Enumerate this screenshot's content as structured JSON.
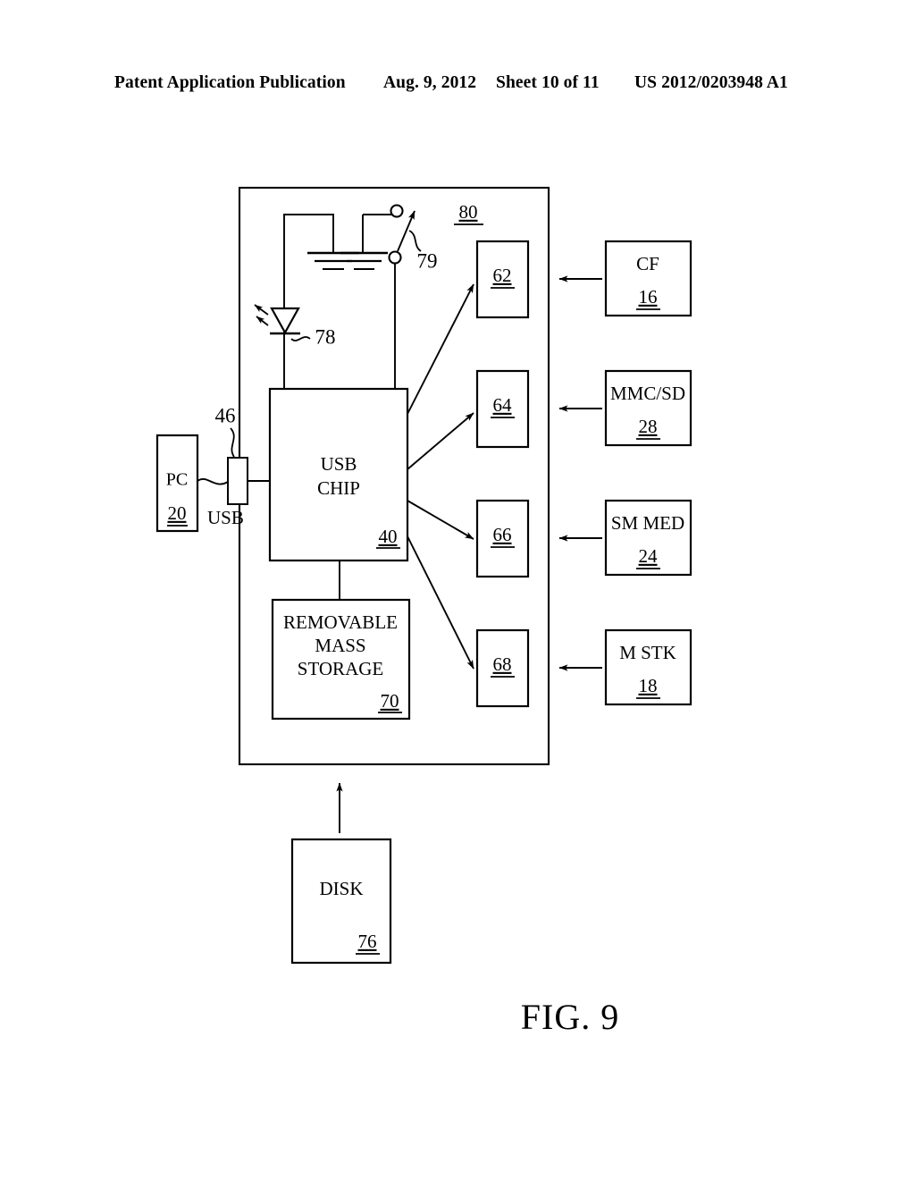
{
  "header": {
    "publication": "Patent Application Publication",
    "date": "Aug. 9, 2012",
    "sheet": "Sheet 10 of 11",
    "number": "US 2012/0203948 A1"
  },
  "figure": {
    "caption": "FIG. 9",
    "enclosure_ref": "80",
    "blocks": [
      {
        "id": "pc",
        "title": "PC",
        "ref": "20"
      },
      {
        "id": "usb-chip",
        "title": "USB\nCHIP",
        "ref": "40"
      },
      {
        "id": "rms",
        "title": "REMOVABLE\nMASS\nSTORAGE",
        "ref": "70"
      },
      {
        "id": "disk",
        "title": "DISK",
        "ref": "76"
      },
      {
        "id": "slot62",
        "title": "",
        "ref": "62"
      },
      {
        "id": "slot64",
        "title": "",
        "ref": "64"
      },
      {
        "id": "slot66",
        "title": "",
        "ref": "66"
      },
      {
        "id": "slot68",
        "title": "",
        "ref": "68"
      },
      {
        "id": "cf",
        "title": "CF",
        "ref": "16"
      },
      {
        "id": "mmcsd",
        "title": "MMC/SD",
        "ref": "28"
      },
      {
        "id": "smmed",
        "title": "SM MED",
        "ref": "24"
      },
      {
        "id": "mstk",
        "title": "M STK",
        "ref": "18"
      }
    ],
    "usb_chip_line1": "USB",
    "usb_chip_line2": "CHIP",
    "rms_line1": "REMOVABLE",
    "rms_line2": "MASS",
    "rms_line3": "STORAGE",
    "connector_label": "USB",
    "connector_ref": "46",
    "led_ref": "78",
    "switch_ref": "79",
    "pc_title": "PC",
    "pc_ref": "20",
    "usb_chip_ref": "40",
    "rms_ref": "70",
    "disk_title": "DISK",
    "disk_ref": "76",
    "slot62_ref": "62",
    "slot64_ref": "64",
    "slot66_ref": "66",
    "slot68_ref": "68",
    "cf_title": "CF",
    "cf_ref": "16",
    "mmcsd_title": "MMC/SD",
    "mmcsd_ref": "28",
    "smmed_title": "SM MED",
    "smmed_ref": "24",
    "mstk_title": "M STK",
    "mstk_ref": "18"
  },
  "colors": {
    "ink": "#000000",
    "paper": "#ffffff"
  }
}
